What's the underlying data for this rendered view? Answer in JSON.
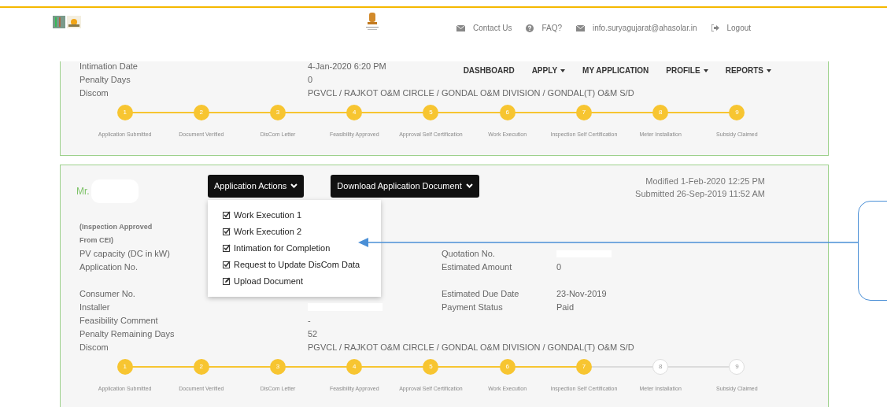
{
  "header": {
    "links": [
      {
        "kind": "mail",
        "label": "Contact Us"
      },
      {
        "kind": "help",
        "label": "FAQ?"
      },
      {
        "kind": "mail",
        "label": "info.suryagujarat@ahasolar.in"
      },
      {
        "kind": "logout",
        "label": "Logout"
      }
    ]
  },
  "nav": [
    {
      "label": "DASHBOARD",
      "dropdown": false
    },
    {
      "label": "APPLY",
      "dropdown": true
    },
    {
      "label": "MY APPLICATION",
      "dropdown": false
    },
    {
      "label": "PROFILE",
      "dropdown": true
    },
    {
      "label": "REPORTS",
      "dropdown": true
    }
  ],
  "cards": [
    {
      "rows": [
        {
          "label": "Intimation Date",
          "value": "4-Jan-2020 6:20 PM"
        },
        {
          "label": "Penalty Days",
          "value": "0"
        },
        {
          "label": "Discom",
          "value": "PGVCL / RAJKOT O&M CIRCLE / GONDAL O&M DIVISION / GONDAL(T) O&M S/D"
        }
      ],
      "steps": [
        {
          "number": "1",
          "label": "Application Submitted",
          "done": true
        },
        {
          "number": "2",
          "label": "Document Verified",
          "done": true
        },
        {
          "number": "3",
          "label": "DisCom Letter",
          "done": true
        },
        {
          "number": "4",
          "label": "Feasibility Approved",
          "done": true
        },
        {
          "number": "5",
          "label": "Approval Self Certification",
          "done": true
        },
        {
          "number": "6",
          "label": "Work Execution",
          "done": true
        },
        {
          "number": "7",
          "label": "Inspection Self Certification",
          "done": true
        },
        {
          "number": "8",
          "label": "Meter Installation",
          "done": true
        },
        {
          "number": "9",
          "label": "Subsidy Claimed",
          "done": true
        }
      ]
    },
    {
      "name": "Mr.",
      "name_redacted": true,
      "buttons": [
        "Application Actions",
        "Download Application Document"
      ],
      "menu": {
        "open": true,
        "items": [
          {
            "kind": "check",
            "label": "Work Execution 1"
          },
          {
            "kind": "check",
            "label": "Work Execution 2"
          },
          {
            "kind": "check",
            "label": "Intimation for Completion"
          },
          {
            "kind": "check",
            "label": "Request to Update DisCom Data"
          },
          {
            "kind": "edit",
            "label": "Upload Document"
          }
        ]
      },
      "modified": "Modified 1-Feb-2020 12:25 PM",
      "submitted": "Submitted 26-Sep-2019 11:52 AM",
      "status_note": [
        "(Inspection Approved",
        "From CEI)"
      ],
      "rows": [
        {
          "label": "PV capacity (DC in kW)",
          "right": {
            "label": "Quotation No.",
            "redacted": true
          }
        },
        {
          "label": "Application No.",
          "right": {
            "label": "Estimated Amount",
            "value": "0"
          }
        },
        {
          "label": "Consumer No.",
          "gap_before": true,
          "right": {
            "label": "Estimated Due Date",
            "value": "23-Nov-2019"
          }
        },
        {
          "label": "Installer",
          "redacted": true,
          "right": {
            "label": "Payment Status",
            "value": "Paid"
          }
        },
        {
          "label": "Feasibility Comment",
          "value": "-"
        },
        {
          "label": "Penalty Remaining Days",
          "value": "52"
        },
        {
          "label": "Discom",
          "value": "PGVCL / RAJKOT O&M CIRCLE / GONDAL O&M DIVISION / GONDAL(T) O&M S/D"
        }
      ],
      "steps": [
        {
          "number": "1",
          "label": "Application Submitted",
          "done": true
        },
        {
          "number": "2",
          "label": "Document Verified",
          "done": true
        },
        {
          "number": "3",
          "label": "DisCom Letter",
          "done": true
        },
        {
          "number": "4",
          "label": "Feasibility Approved",
          "done": true
        },
        {
          "number": "5",
          "label": "Approval Self Certification",
          "done": true
        },
        {
          "number": "6",
          "label": "Work Execution",
          "done": true
        },
        {
          "number": "7",
          "label": "Inspection Self Certification",
          "done": true
        },
        {
          "number": "8",
          "label": "Meter Installation",
          "done": false
        },
        {
          "number": "9",
          "label": "Subsidy Claimed",
          "done": false
        }
      ]
    }
  ],
  "callout": {
    "visible": true
  }
}
